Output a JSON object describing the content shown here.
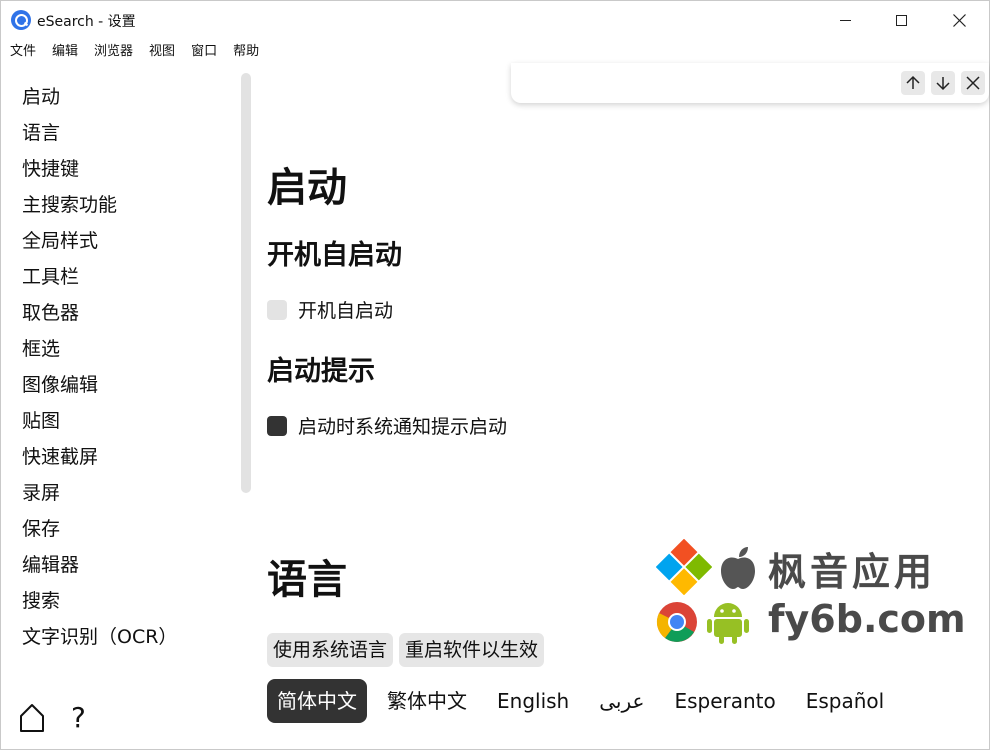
{
  "window": {
    "title": "eSearch - 设置"
  },
  "menu": [
    "文件",
    "编辑",
    "浏览器",
    "视图",
    "窗口",
    "帮助"
  ],
  "sidebar": {
    "items": [
      "启动",
      "语言",
      "快捷键",
      "主搜索功能",
      "全局样式",
      "工具栏",
      "取色器",
      "框选",
      "图像编辑",
      "贴图",
      "快速截屏",
      "录屏",
      "保存",
      "编辑器",
      "搜索",
      "文字识别（OCR）"
    ],
    "help_label": "?"
  },
  "findbar": {
    "value": "",
    "placeholder": ""
  },
  "startup": {
    "heading": "启动",
    "autostart_heading": "开机自启动",
    "autostart_label": "开机自启动",
    "autostart_checked": false,
    "notify_heading": "启动提示",
    "notify_label": "启动时系统通知提示启动",
    "notify_checked": true
  },
  "language": {
    "heading": "语言",
    "use_system_label": "使用系统语言",
    "restart_label": "重启软件以生效",
    "options": [
      "简体中文",
      "繁体中文",
      "English",
      "عربى",
      "Esperanto",
      "Español"
    ],
    "selected": "简体中文"
  },
  "watermark": {
    "line1": "枫音应用",
    "line2": "fy6b.com"
  },
  "colors": {
    "accent": "#333333",
    "checkbox_off": "#e3e3e3",
    "app_icon": "#2f73e8"
  }
}
